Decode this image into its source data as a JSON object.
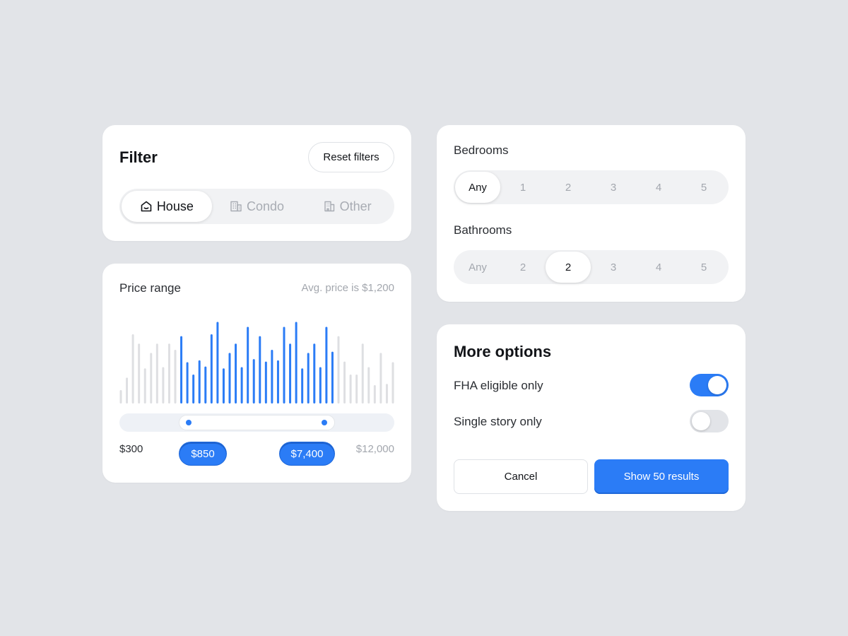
{
  "filter": {
    "title": "Filter",
    "reset_label": "Reset filters",
    "property_types": [
      {
        "label": "House",
        "icon": "house-icon",
        "active": true
      },
      {
        "label": "Condo",
        "icon": "condo-building-icon",
        "active": false
      },
      {
        "label": "Other",
        "icon": "other-building-icon",
        "active": false
      }
    ]
  },
  "price": {
    "title": "Price range",
    "avg_text": "Avg. price is $1,200",
    "min_label": "$300",
    "max_label": "$12,000",
    "selected_min": "$850",
    "selected_max": "$7,400"
  },
  "chart_data": {
    "type": "bar",
    "series": [
      {
        "values": [
          2,
          4,
          11,
          9.5,
          5.5,
          8,
          9.5,
          5.7,
          9.5,
          8.5,
          10.7,
          6.5,
          4.5,
          6.8,
          5.8,
          11,
          13,
          5.5,
          8,
          9.5,
          5.7,
          12.2,
          7,
          10.7,
          6.6,
          8.5,
          6.8,
          12.2,
          9.5,
          13,
          5.5,
          8,
          9.5,
          5.7,
          12.2,
          8.2,
          10.7,
          6.6,
          4.5,
          4.5,
          9.5,
          5.7,
          2.8,
          8,
          3,
          6.5
        ]
      }
    ],
    "highlight_range": [
      10,
      35
    ],
    "colors": {
      "highlight": "#2b7cf6",
      "muted": "#dedfe2"
    }
  },
  "bedrooms": {
    "label": "Bedrooms",
    "options": [
      "Any",
      "1",
      "2",
      "3",
      "4",
      "5"
    ],
    "selected_index": 0
  },
  "bathrooms": {
    "label": "Bathrooms",
    "options": [
      "Any",
      "2",
      "2",
      "3",
      "4",
      "5"
    ],
    "selected_index": 2
  },
  "more_options": {
    "title": "More options",
    "items": [
      {
        "label": "FHA eligible only",
        "enabled": true
      },
      {
        "label": "Single story only",
        "enabled": false
      }
    ],
    "cancel_label": "Cancel",
    "show_label": "Show 50 results"
  },
  "colors": {
    "accent": "#2b7cf6",
    "background": "#e2e4e8",
    "card": "#ffffff"
  }
}
